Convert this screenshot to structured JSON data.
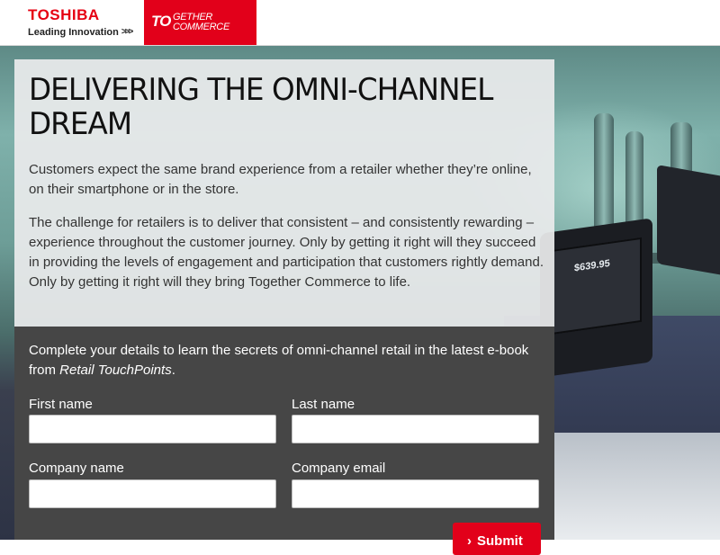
{
  "header": {
    "brand": "TOSHIBA",
    "tagline": "Leading Innovation",
    "tagline_arrows": ">>>",
    "badge_mark": "TO",
    "badge_line1": "GETHER",
    "badge_line2": "COMMERCE"
  },
  "scene": {
    "terminal_price": "$639.95"
  },
  "content": {
    "headline_line1": "DELIVERING THE OMNI-CHANNEL",
    "headline_line2": "DREAM",
    "paragraph1": "Customers expect the same brand experience from a retailer whether they’re online, on their smartphone or in the store.",
    "paragraph2": "The challenge for retailers is to deliver that consistent – and consistently rewarding – experience throughout the customer journey. Only by getting it right will they succeed in providing the levels of engagement and participation that customers rightly demand. Only by getting it right will they bring Together Commerce to life."
  },
  "form": {
    "intro_text": "Complete your details to learn the secrets of omni-channel retail in the latest e-book from ",
    "intro_source": "Retail TouchPoints",
    "intro_end": ".",
    "first_name_label": "First name",
    "first_name_value": "",
    "last_name_label": "Last name",
    "last_name_value": "",
    "company_name_label": "Company name",
    "company_name_value": "",
    "company_email_label": "Company email",
    "company_email_value": "",
    "submit_label": "Submit",
    "submit_icon": "chevron-right-icon"
  },
  "colors": {
    "brand_red": "#e2001a",
    "dark_panel": "#464646",
    "light_panel": "#eaebec"
  }
}
